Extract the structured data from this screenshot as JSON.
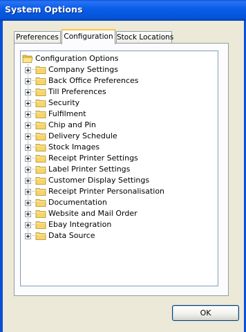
{
  "window": {
    "title": "System Options"
  },
  "tabs": [
    {
      "label": "Preferences",
      "selected": false
    },
    {
      "label": "Configuration",
      "selected": true
    },
    {
      "label": "Stock Locations",
      "selected": false
    }
  ],
  "tree": {
    "root": {
      "label": "Configuration Options",
      "icon": "open-folder-icon"
    },
    "items": [
      {
        "label": "Company Settings",
        "icon": "folder-icon"
      },
      {
        "label": "Back Office Preferences",
        "icon": "folder-icon"
      },
      {
        "label": "Till Preferences",
        "icon": "folder-icon"
      },
      {
        "label": "Security",
        "icon": "folder-icon"
      },
      {
        "label": "Fulfilment",
        "icon": "folder-icon"
      },
      {
        "label": "Chip and Pin",
        "icon": "folder-icon"
      },
      {
        "label": "Delivery Schedule",
        "icon": "folder-icon"
      },
      {
        "label": "Stock Images",
        "icon": "folder-icon"
      },
      {
        "label": "Receipt Printer Settings",
        "icon": "folder-icon"
      },
      {
        "label": "Label Printer Settings",
        "icon": "folder-icon"
      },
      {
        "label": "Customer Display Settings",
        "icon": "folder-icon"
      },
      {
        "label": "Receipt Printer Personalisation",
        "icon": "folder-icon"
      },
      {
        "label": "Documentation",
        "icon": "folder-icon"
      },
      {
        "label": "Website and Mail Order",
        "icon": "folder-icon"
      },
      {
        "label": "Ebay Integration",
        "icon": "folder-icon"
      },
      {
        "label": "Data Source",
        "icon": "folder-icon"
      }
    ]
  },
  "buttons": {
    "ok_label": "OK"
  },
  "colors": {
    "titlebar": "#0a5ee8",
    "window_bg": "#ece9d8",
    "active_tab_accent": "#ffc83c",
    "folder": "#f6d56b"
  }
}
